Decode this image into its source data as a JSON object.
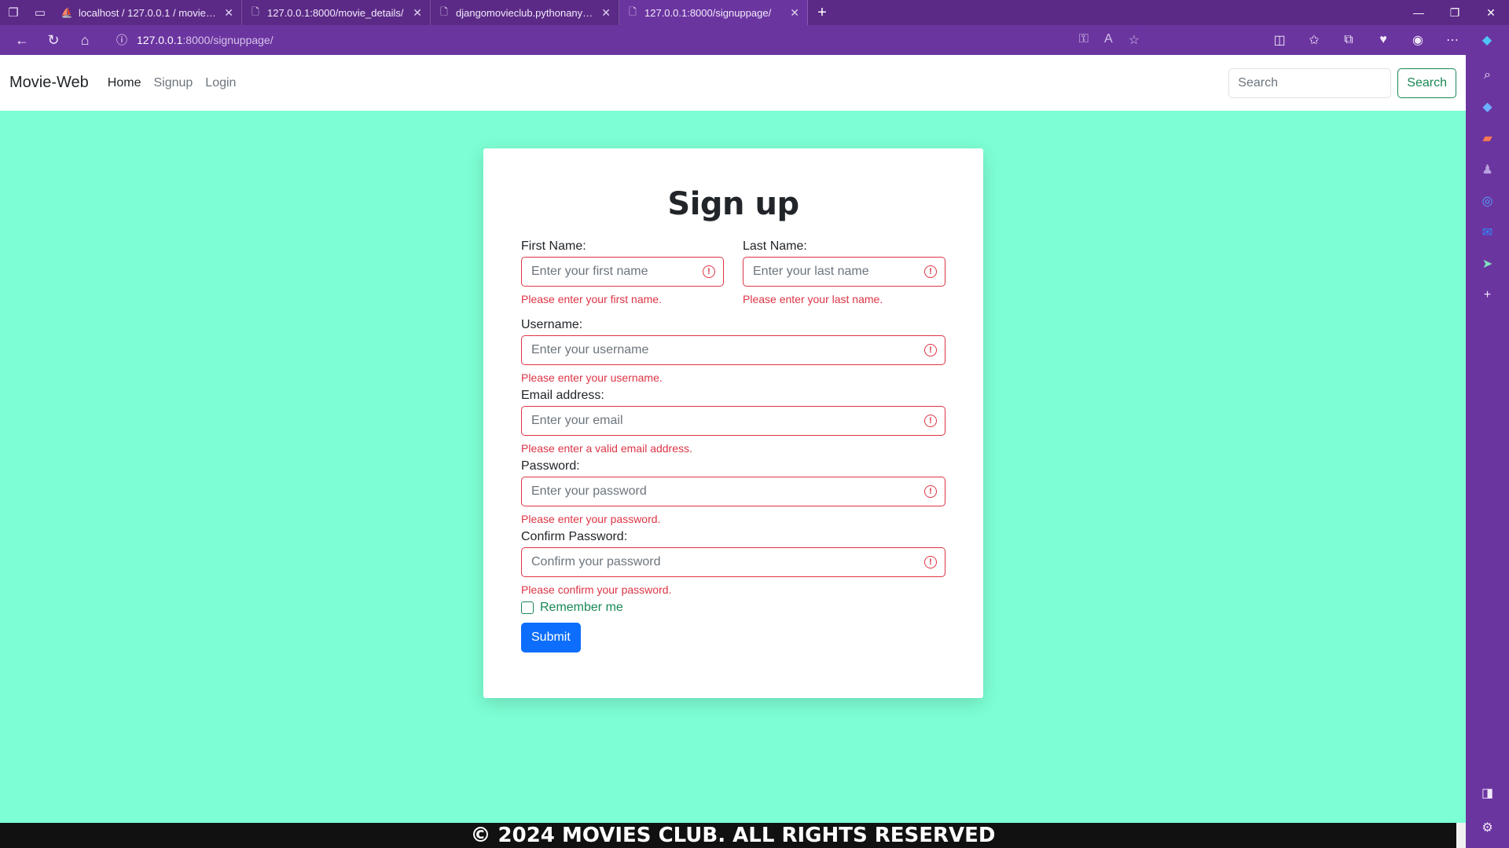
{
  "browser": {
    "tabs": [
      {
        "title": "localhost / 127.0.0.1 / movies_db",
        "icon": "phpmyadmin-icon"
      },
      {
        "title": "127.0.0.1:8000/movie_details/",
        "icon": "page-icon"
      },
      {
        "title": "djangomovieclub.pythonanywhere",
        "icon": "page-icon"
      },
      {
        "title": "127.0.0.1:8000/signuppage/",
        "icon": "page-icon",
        "active": true
      }
    ],
    "url_host": "127.0.0.1",
    "url_path": ":8000/signuppage/"
  },
  "navbar": {
    "brand": "Movie-Web",
    "links": [
      "Home",
      "Signup",
      "Login"
    ],
    "search_placeholder": "Search",
    "search_button": "Search"
  },
  "form": {
    "title": "Sign up",
    "first_name": {
      "label": "First Name:",
      "placeholder": "Enter your first name",
      "error": "Please enter your first name."
    },
    "last_name": {
      "label": "Last Name:",
      "placeholder": "Enter your last name",
      "error": "Please enter your last name."
    },
    "username": {
      "label": "Username:",
      "placeholder": "Enter your username",
      "error": "Please enter your username."
    },
    "email": {
      "label": "Email address:",
      "placeholder": "Enter your email",
      "error": "Please enter a valid email address."
    },
    "password": {
      "label": "Password:",
      "placeholder": "Enter your password",
      "error": "Please enter your password."
    },
    "confirm_password": {
      "label": "Confirm Password:",
      "placeholder": "Confirm your password",
      "error": "Please confirm your password."
    },
    "remember": "Remember me",
    "submit": "Submit"
  },
  "footer": "© 2024 MOVIES CLUB. ALL RIGHTS RESERVED",
  "colors": {
    "page_bg": "#7dfed4",
    "browser_chrome": "#6b35a0",
    "error": "#dc3545",
    "primary": "#0d6efd",
    "success": "#198754"
  }
}
